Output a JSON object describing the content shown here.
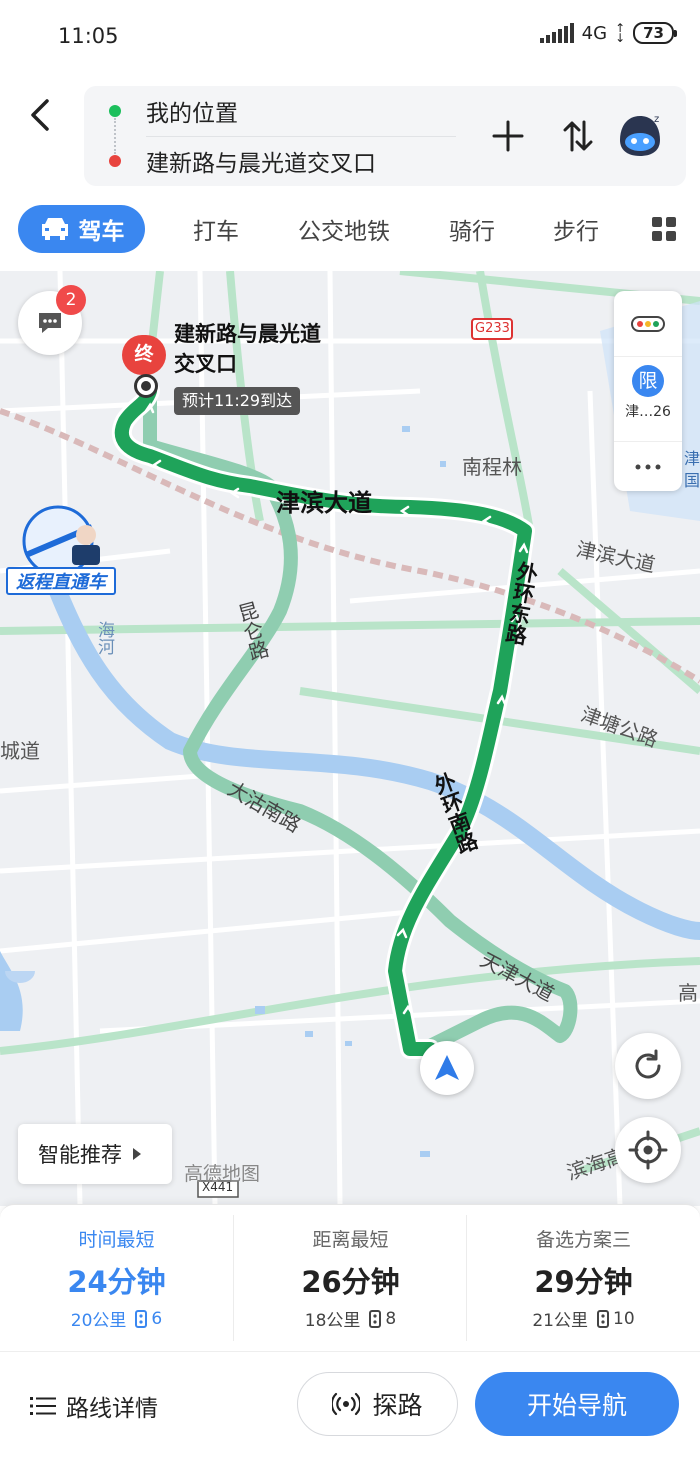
{
  "status_bar": {
    "time": "11:05",
    "network": "4G",
    "battery": "73"
  },
  "header": {
    "origin": "我的位置",
    "destination": "建新路与晨光道交叉口",
    "colors": {
      "origin_dot": "#1cbf5c",
      "destination_dot": "#e8433e"
    }
  },
  "tabs": [
    {
      "label": "驾车",
      "active": true
    },
    {
      "label": "打车",
      "active": false
    },
    {
      "label": "公交地铁",
      "active": false
    },
    {
      "label": "骑行",
      "active": false
    },
    {
      "label": "步行",
      "active": false
    }
  ],
  "map": {
    "chat_badge": "2",
    "destination_label": "建新路与晨光道交叉口",
    "destination_pin": "终",
    "eta": "预计11:29到达",
    "limit_icon": "限",
    "limit_text": "津…26",
    "promo": "返程直通车",
    "smart_recommend": "智能推荐",
    "watermark": "高德地图",
    "road_labels": {
      "jinbin_main": "津滨大道",
      "jinbin_right": "津滨大道",
      "waihuan_east": "外环东路",
      "waihuan_south": "外环南路",
      "kunlun": "昆仑路",
      "dagu_south": "大沽南路",
      "tianjin": "天津大道",
      "jintang": "津塘公路",
      "nanchenglin": "南程林",
      "haihe": "海河",
      "g233": "G233",
      "x441": "X441",
      "chengdao": "城道",
      "gao": "高",
      "expressway": "滨海高速",
      "jin_right": "津",
      "guoji": "国际"
    },
    "colors": {
      "route_main": "#1fa35a",
      "route_alt": "#8fcdb0",
      "river": "#a9cdf2"
    }
  },
  "options": [
    {
      "title": "时间最短",
      "time": "24分钟",
      "distance": "20公里",
      "lights": "6",
      "active": true
    },
    {
      "title": "距离最短",
      "time": "26分钟",
      "distance": "18公里",
      "lights": "8",
      "active": false
    },
    {
      "title": "备选方案三",
      "time": "29分钟",
      "distance": "21公里",
      "lights": "10",
      "active": false
    }
  ],
  "bottom": {
    "details": "路线详情",
    "probe": "探路",
    "start": "开始导航",
    "accent": "#3a87f0"
  }
}
